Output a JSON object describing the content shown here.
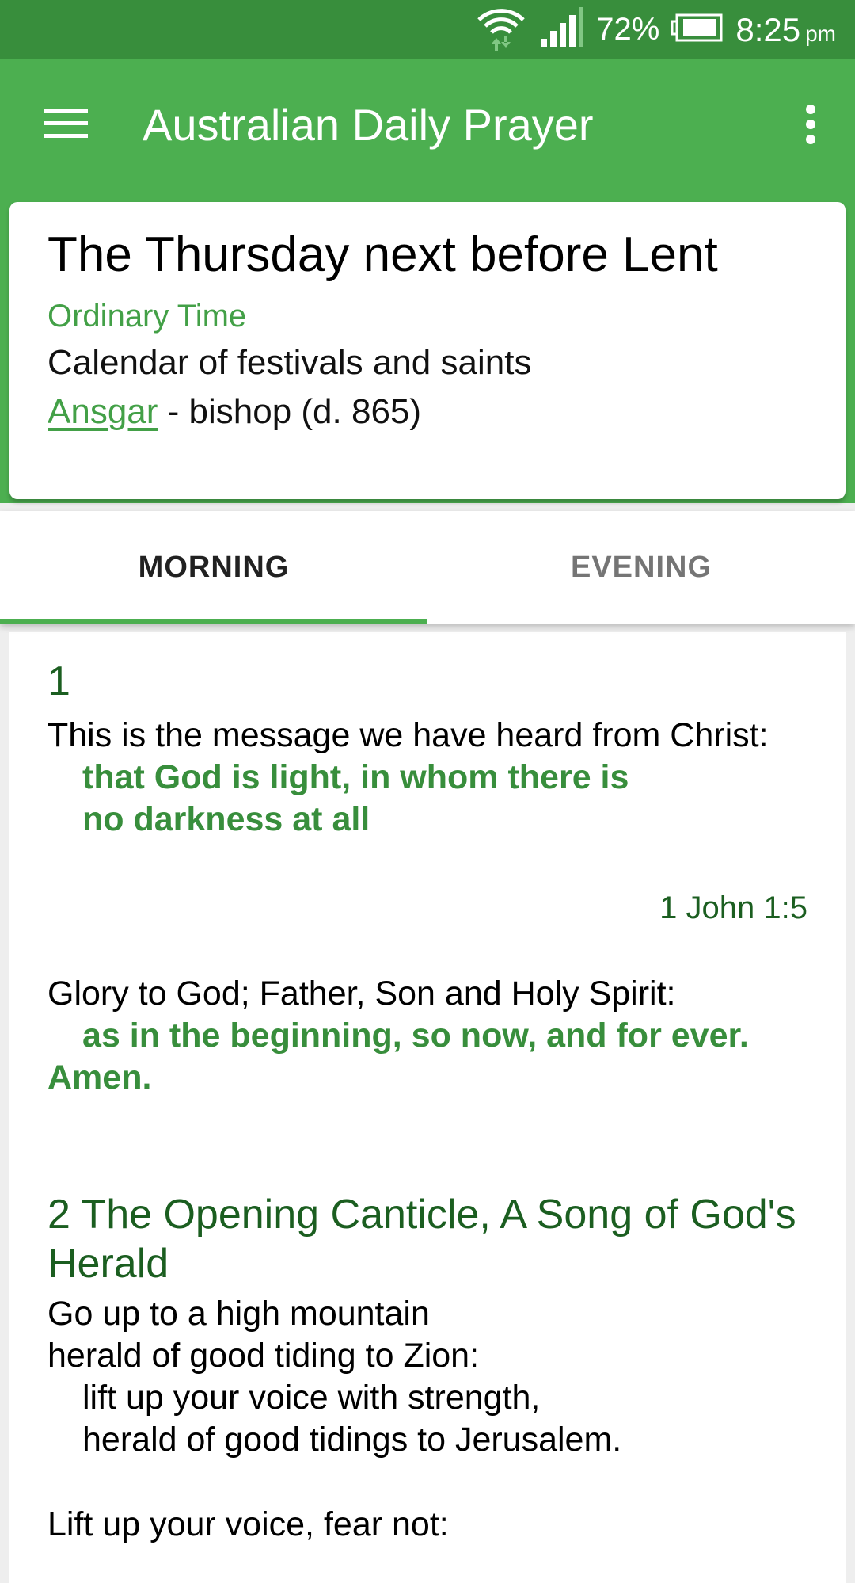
{
  "status_bar": {
    "wifi_icon": "wifi-icon",
    "signal_icon": "cell-signal-icon",
    "battery_percent": "72%",
    "battery_icon": "battery-icon",
    "time": "8:25",
    "ampm": "pm"
  },
  "app_bar": {
    "menu_icon": "hamburger-menu-icon",
    "title": "Australian Daily Prayer",
    "overflow_icon": "more-vert-icon"
  },
  "day_card": {
    "title": "The Thursday next before Lent",
    "season": "Ordinary Time",
    "calendar_label": "Calendar of festivals and saints",
    "saint_name": "Ansgar",
    "saint_detail": " - bishop (d. 865)"
  },
  "tabs": [
    {
      "label": "MORNING",
      "active": true
    },
    {
      "label": "EVENING",
      "active": false
    }
  ],
  "content": {
    "section1": {
      "number": "1",
      "lines": [
        {
          "text": "This is the message we have heard from Christ:",
          "style": "normal"
        },
        {
          "text": "that God is light, in whom there is",
          "style": "response"
        },
        {
          "text": "no darkness at all",
          "style": "response"
        }
      ],
      "reference": "1 John 1:5",
      "gloria": [
        {
          "text": "Glory to God; Father, Son and Holy Spirit:",
          "style": "normal"
        },
        {
          "text": "as in the beginning, so now, and for ever.",
          "style": "response"
        },
        {
          "text": "Amen.",
          "style": "response-noindent"
        }
      ]
    },
    "section2": {
      "heading_line1": "2 The Opening Canticle, A Song of God's",
      "heading_line2": "Herald",
      "lines": [
        {
          "text": "Go up to a high mountain",
          "style": "normal"
        },
        {
          "text": "herald of good tiding to Zion:",
          "style": "normal"
        },
        {
          "text": "lift up your voice with strength,",
          "style": "indent"
        },
        {
          "text": "herald of good tidings to Jerusalem.",
          "style": "indent"
        },
        {
          "text": "Lift up your voice, fear not:",
          "style": "normal"
        }
      ]
    }
  }
}
